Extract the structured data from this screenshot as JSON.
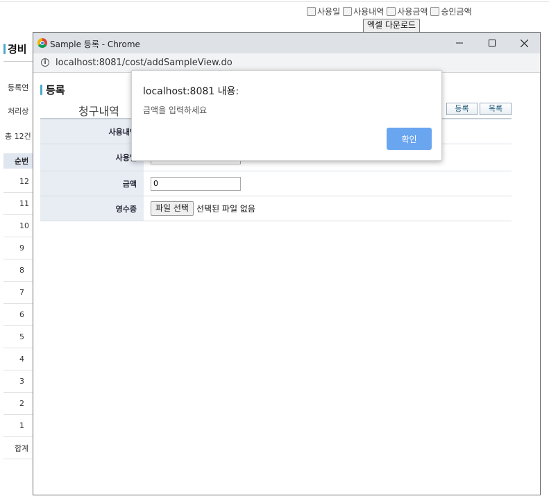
{
  "background": {
    "checkboxes": [
      {
        "label": "사용일"
      },
      {
        "label": "사용내역"
      },
      {
        "label": "사용금액"
      },
      {
        "label": "승인금액"
      }
    ],
    "excel_button": "엑셀 다운로드",
    "title": "경비",
    "filter_labels": [
      "등록연",
      "처리상"
    ],
    "total_text": "총 12건",
    "table_header": "순번",
    "rows": [
      "12",
      "11",
      "10",
      "9",
      "8",
      "7",
      "6",
      "5",
      "4",
      "3",
      "2",
      "1",
      "합계"
    ]
  },
  "popup": {
    "window_title": "Sample 등록 - Chrome",
    "url": "localhost:8081/cost/addSampleView.do",
    "page_title": "등록",
    "section_title": "청구내역",
    "register_button": "등록",
    "list_button": "목록",
    "form": {
      "usage_detail_label": "사용내역",
      "usage_date_label": "사용일",
      "amount_label": "금액",
      "amount_value": "0",
      "receipt_label": "영수증",
      "file_button": "파일 선택",
      "file_status": "선택된 파일 없음"
    }
  },
  "alert": {
    "title": "localhost:8081 내용:",
    "message": "금액을 입력하세요",
    "ok_button": "확인"
  },
  "colors": {
    "accent_bar": "#4aa9c9",
    "table_header_bg": "#e7edf3",
    "dialog_ok": "#6aa5f0",
    "titlebar": "#dee1e6"
  }
}
